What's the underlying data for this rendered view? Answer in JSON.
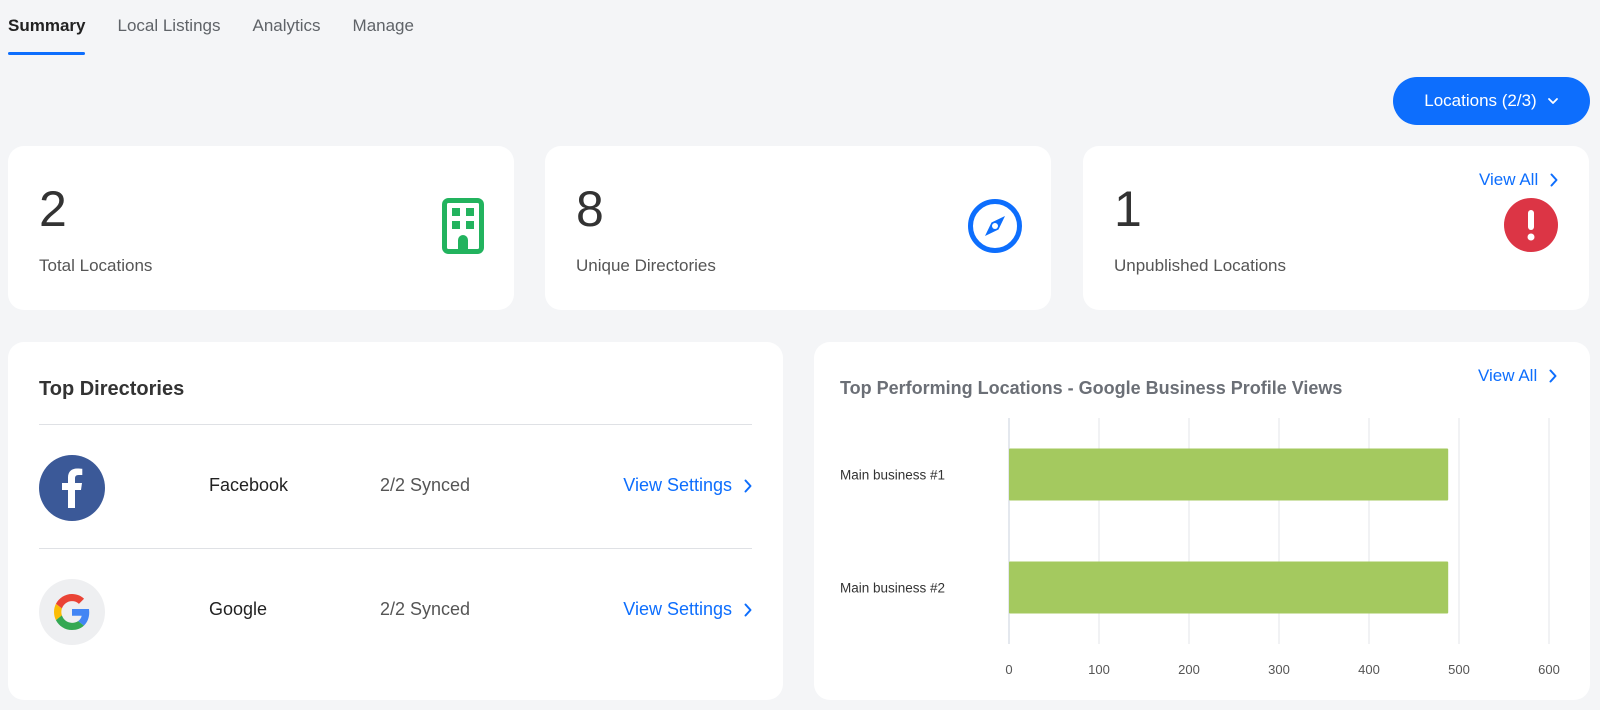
{
  "tabs": [
    {
      "label": "Summary",
      "active": true
    },
    {
      "label": "Local Listings",
      "active": false
    },
    {
      "label": "Analytics",
      "active": false
    },
    {
      "label": "Manage",
      "active": false
    }
  ],
  "locations_button": {
    "label": "Locations (2/3)",
    "icon": "chevron-down-icon"
  },
  "stats": [
    {
      "value": "2",
      "label": "Total Locations",
      "icon": "building-icon",
      "color": "#22b35e"
    },
    {
      "value": "8",
      "label": "Unique Directories",
      "icon": "compass-icon",
      "color": "#0d6efd"
    },
    {
      "value": "1",
      "label": "Unpublished Locations",
      "icon": "alert-icon",
      "color": "#dc3545",
      "link": "View All"
    }
  ],
  "directories": {
    "title": "Top Directories",
    "items": [
      {
        "name": "Facebook",
        "status": "2/2 Synced",
        "link": "View Settings",
        "icon": "facebook-icon"
      },
      {
        "name": "Google",
        "status": "2/2 Synced",
        "link": "View Settings",
        "icon": "google-icon"
      }
    ]
  },
  "chart_card": {
    "title": "Top Performing Locations - Google Business Profile Views",
    "link": "View All"
  },
  "chart_data": {
    "type": "bar",
    "orientation": "horizontal",
    "title": "Top Performing Locations - Google Business Profile Views",
    "categories": [
      "Main business #1",
      "Main business #2"
    ],
    "values": [
      488,
      488
    ],
    "xlim": [
      0,
      600
    ],
    "xticks": [
      0,
      100,
      200,
      300,
      400,
      500,
      600
    ],
    "grid": true,
    "bar_color": "#a4c95f"
  },
  "colors": {
    "accent": "#0d6efd",
    "success": "#22b35e",
    "danger": "#dc3545",
    "facebook": "#3b5998"
  }
}
